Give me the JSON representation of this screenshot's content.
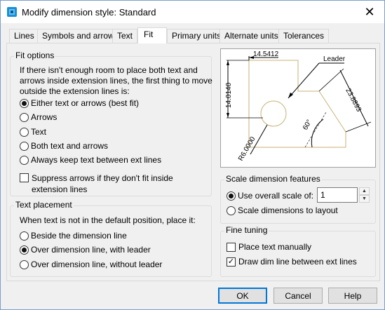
{
  "window": {
    "title": "Modify dimension style: Standard",
    "close_glyph": "✕"
  },
  "tabs": [
    {
      "label": "Lines",
      "active": false
    },
    {
      "label": "Symbols and arrows",
      "active": false
    },
    {
      "label": "Text",
      "active": false
    },
    {
      "label": "Fit",
      "active": true
    },
    {
      "label": "Primary units",
      "active": false
    },
    {
      "label": "Alternate units",
      "active": false
    },
    {
      "label": "Tolerances",
      "active": false
    }
  ],
  "fit_options": {
    "title": "Fit options",
    "description_lines": [
      "If there isn't enough room to place both text and",
      "arrows inside extension lines, the first thing to move",
      "outside the extension lines is:"
    ],
    "options": [
      {
        "label": "Either text or arrows (best fit)",
        "selected": true
      },
      {
        "label": "Arrows",
        "selected": false
      },
      {
        "label": "Text",
        "selected": false
      },
      {
        "label": "Both text and arrows",
        "selected": false
      },
      {
        "label": "Always keep text between ext lines",
        "selected": false
      }
    ],
    "suppress": {
      "label_line1": "Suppress arrows if they don't fit inside",
      "label_line2": "extension lines",
      "checked": false
    }
  },
  "text_placement": {
    "title": "Text placement",
    "description": "When text is not in the default position, place it:",
    "options": [
      {
        "label": "Beside the dimension line",
        "selected": false
      },
      {
        "label": "Over dimension line, with leader",
        "selected": true
      },
      {
        "label": "Over dimension line, without leader",
        "selected": false
      }
    ]
  },
  "preview": {
    "dim_top": "14.5412",
    "dim_left": "14.0140",
    "leader": "Leader",
    "dim_diag": "23.8893",
    "angle": "60°",
    "radius": "R6.0000"
  },
  "scale": {
    "title": "Scale dimension features",
    "use_overall_label": "Use overall scale of:",
    "use_overall_selected": true,
    "scale_value": "1",
    "scale_to_layout_label": "Scale dimensions to layout",
    "scale_to_layout_selected": false,
    "spin_up": "▲",
    "spin_down": "▼"
  },
  "fine_tuning": {
    "title": "Fine tuning",
    "place_text_manually": {
      "label": "Place text manually",
      "checked": false
    },
    "draw_dim_line": {
      "label": "Draw dim line between ext lines",
      "checked": true
    },
    "check_glyph": "✓"
  },
  "buttons": {
    "ok": "OK",
    "cancel": "Cancel",
    "help": "Help"
  }
}
